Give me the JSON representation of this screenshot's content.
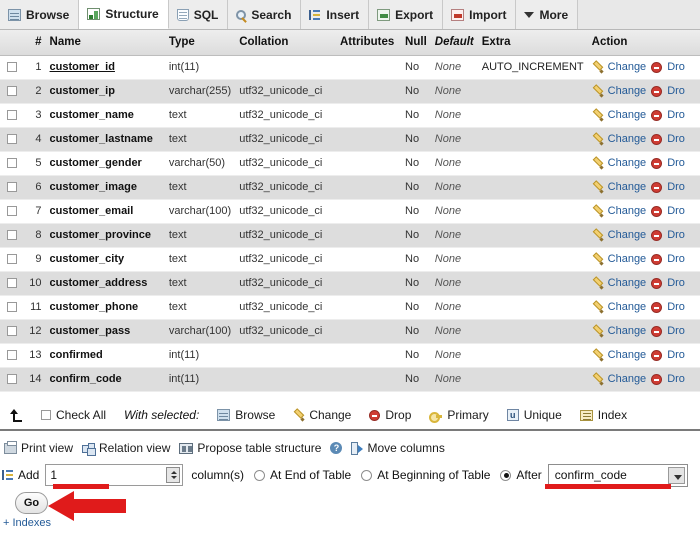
{
  "tabs": [
    {
      "label": "Browse",
      "icon": "browse-icon",
      "active": false
    },
    {
      "label": "Structure",
      "icon": "structure-icon",
      "active": true
    },
    {
      "label": "SQL",
      "icon": "sql-icon",
      "active": false
    },
    {
      "label": "Search",
      "icon": "search-icon",
      "active": false
    },
    {
      "label": "Insert",
      "icon": "insert-icon",
      "active": false
    },
    {
      "label": "Export",
      "icon": "export-icon",
      "active": false
    },
    {
      "label": "Import",
      "icon": "import-icon",
      "active": false
    },
    {
      "label": "More",
      "icon": "chevron-down-icon",
      "active": false
    }
  ],
  "table": {
    "headers": [
      "",
      "#",
      "Name",
      "Type",
      "Collation",
      "Attributes",
      "Null",
      "Default",
      "Extra",
      "Action"
    ],
    "action_labels": {
      "change": "Change",
      "drop": "Dro"
    },
    "rows": [
      {
        "num": "1",
        "name": "customer_id",
        "type": "int(11)",
        "collation": "",
        "attributes": "",
        "null": "No",
        "default": "None",
        "extra": "AUTO_INCREMENT",
        "primary": true
      },
      {
        "num": "2",
        "name": "customer_ip",
        "type": "varchar(255)",
        "collation": "utf32_unicode_ci",
        "attributes": "",
        "null": "No",
        "default": "None",
        "extra": "",
        "primary": false
      },
      {
        "num": "3",
        "name": "customer_name",
        "type": "text",
        "collation": "utf32_unicode_ci",
        "attributes": "",
        "null": "No",
        "default": "None",
        "extra": "",
        "primary": false
      },
      {
        "num": "4",
        "name": "customer_lastname",
        "type": "text",
        "collation": "utf32_unicode_ci",
        "attributes": "",
        "null": "No",
        "default": "None",
        "extra": "",
        "primary": false
      },
      {
        "num": "5",
        "name": "customer_gender",
        "type": "varchar(50)",
        "collation": "utf32_unicode_ci",
        "attributes": "",
        "null": "No",
        "default": "None",
        "extra": "",
        "primary": false
      },
      {
        "num": "6",
        "name": "customer_image",
        "type": "text",
        "collation": "utf32_unicode_ci",
        "attributes": "",
        "null": "No",
        "default": "None",
        "extra": "",
        "primary": false
      },
      {
        "num": "7",
        "name": "customer_email",
        "type": "varchar(100)",
        "collation": "utf32_unicode_ci",
        "attributes": "",
        "null": "No",
        "default": "None",
        "extra": "",
        "primary": false
      },
      {
        "num": "8",
        "name": "customer_province",
        "type": "text",
        "collation": "utf32_unicode_ci",
        "attributes": "",
        "null": "No",
        "default": "None",
        "extra": "",
        "primary": false
      },
      {
        "num": "9",
        "name": "customer_city",
        "type": "text",
        "collation": "utf32_unicode_ci",
        "attributes": "",
        "null": "No",
        "default": "None",
        "extra": "",
        "primary": false
      },
      {
        "num": "10",
        "name": "customer_address",
        "type": "text",
        "collation": "utf32_unicode_ci",
        "attributes": "",
        "null": "No",
        "default": "None",
        "extra": "",
        "primary": false
      },
      {
        "num": "11",
        "name": "customer_phone",
        "type": "text",
        "collation": "utf32_unicode_ci",
        "attributes": "",
        "null": "No",
        "default": "None",
        "extra": "",
        "primary": false
      },
      {
        "num": "12",
        "name": "customer_pass",
        "type": "varchar(100)",
        "collation": "utf32_unicode_ci",
        "attributes": "",
        "null": "No",
        "default": "None",
        "extra": "",
        "primary": false
      },
      {
        "num": "13",
        "name": "confirmed",
        "type": "int(11)",
        "collation": "",
        "attributes": "",
        "null": "No",
        "default": "None",
        "extra": "",
        "primary": false
      },
      {
        "num": "14",
        "name": "confirm_code",
        "type": "int(11)",
        "collation": "",
        "attributes": "",
        "null": "No",
        "default": "None",
        "extra": "",
        "primary": false
      }
    ]
  },
  "selected_bar": {
    "check_all": "Check All",
    "with_selected": "With selected:",
    "actions": [
      {
        "label": "Browse",
        "icon": "browse-icon"
      },
      {
        "label": "Change",
        "icon": "pencil-icon"
      },
      {
        "label": "Drop",
        "icon": "drop-icon"
      },
      {
        "label": "Primary",
        "icon": "key-icon"
      },
      {
        "label": "Unique",
        "icon": "unique-icon"
      },
      {
        "label": "Index",
        "icon": "index-icon"
      }
    ]
  },
  "views_bar": [
    {
      "label": "Print view",
      "icon": "printer-icon"
    },
    {
      "label": "Relation view",
      "icon": "relation-icon"
    },
    {
      "label": "Propose table structure",
      "icon": "propose-icon"
    },
    {
      "label": "",
      "icon": "help-icon"
    },
    {
      "label": "Move columns",
      "icon": "move-columns-icon"
    }
  ],
  "add_form": {
    "add_label": "Add",
    "count_value": "1",
    "columns_label": "column(s)",
    "position_options": [
      {
        "label": "At End of Table",
        "selected": false
      },
      {
        "label": "At Beginning of Table",
        "selected": false
      },
      {
        "label": "After",
        "selected": true
      }
    ],
    "after_column": "confirm_code",
    "go_label": "Go"
  },
  "footer": {
    "indexes_link": "+ Indexes"
  },
  "annotation": {
    "color": "#e01b1b"
  }
}
